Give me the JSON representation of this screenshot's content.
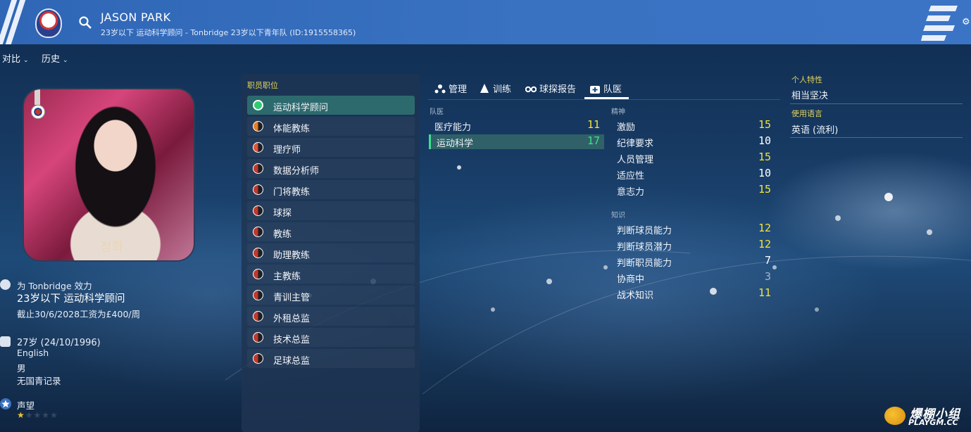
{
  "header": {
    "name": "JASON PARK",
    "subtitle": "23岁以下 运动科学顾问 - Tonbridge 23岁以下青年队 (ID:1915558365)"
  },
  "subnav": {
    "compare": "对比",
    "history": "历史"
  },
  "profile": {
    "photo_caption": "정화",
    "plays_for": "为 Tonbridge 效力",
    "role": "23岁以下 运动科学顾问",
    "contract": "截止30/6/2028工资为£400/周",
    "age": "27岁 (24/10/1996)",
    "nationality": "English",
    "gender": "男",
    "record": "无国青记录",
    "reputation_label": "声望",
    "reputation_stars": 1,
    "reputation_max": 5
  },
  "jobs": {
    "title": "职员职位",
    "items": [
      {
        "label": "运动科学顾问",
        "color": "#2ecc71",
        "active": true
      },
      {
        "label": "体能教练",
        "color": "#e67e22"
      },
      {
        "label": "理疗师",
        "color": "#e0533a"
      },
      {
        "label": "数据分析师",
        "color": "#c0392b"
      },
      {
        "label": "门将教练",
        "color": "#c0392b"
      },
      {
        "label": "球探",
        "color": "#c0392b"
      },
      {
        "label": "教练",
        "color": "#c0392b"
      },
      {
        "label": "助理教练",
        "color": "#c0392b"
      },
      {
        "label": "主教练",
        "color": "#c0392b"
      },
      {
        "label": "青训主管",
        "color": "#c0392b"
      },
      {
        "label": "外租总监",
        "color": "#c0392b"
      },
      {
        "label": "技术总监",
        "color": "#c0392b"
      },
      {
        "label": "足球总监",
        "color": "#c0392b"
      }
    ]
  },
  "tabs": {
    "management": "管理",
    "training": "训练",
    "scouting": "球探报告",
    "medical": "队医"
  },
  "medical": {
    "section": "队医",
    "items": [
      {
        "name": "医疗能力",
        "value": "11",
        "color": "#f1e33b"
      },
      {
        "name": "运动科学",
        "value": "17",
        "color": "#3ee08a"
      }
    ]
  },
  "mental": {
    "section": "精神",
    "items": [
      {
        "name": "激励",
        "value": "15",
        "color": "#f1e33b"
      },
      {
        "name": "纪律要求",
        "value": "10",
        "color": "#ffffff"
      },
      {
        "name": "人员管理",
        "value": "15",
        "color": "#f1e33b"
      },
      {
        "name": "适应性",
        "value": "10",
        "color": "#ffffff"
      },
      {
        "name": "意志力",
        "value": "15",
        "color": "#f1e33b"
      }
    ]
  },
  "knowledge": {
    "section": "知识",
    "items": [
      {
        "name": "判断球员能力",
        "value": "12",
        "color": "#f1e33b"
      },
      {
        "name": "判断球员潜力",
        "value": "12",
        "color": "#f1e33b"
      },
      {
        "name": "判断职员能力",
        "value": "7",
        "color": "#ffffff"
      },
      {
        "name": "协商中",
        "value": "3",
        "color": "#a7b3c4"
      },
      {
        "name": "战术知识",
        "value": "11",
        "color": "#f1e33b"
      }
    ]
  },
  "right": {
    "personality_label": "个人特性",
    "personality": "相当坚决",
    "language_label": "使用语言",
    "language": "英语 (流利)"
  },
  "watermark": {
    "cn": "爆棚小组",
    "en": "PLAYGM.CC",
    "badge": "ps"
  },
  "colors": {
    "header": "#3a72c2",
    "accent_yellow": "#f1e33b",
    "accent_green": "#3ee08a"
  }
}
